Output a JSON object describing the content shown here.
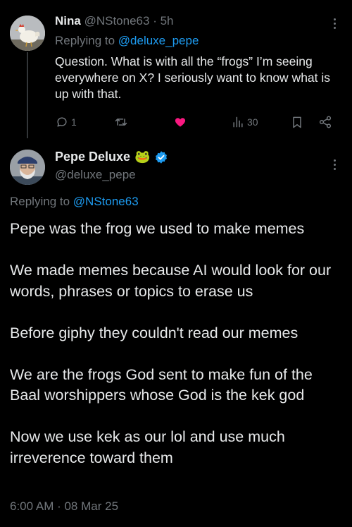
{
  "parent_tweet": {
    "display_name": "Nina",
    "handle": "@NStone63",
    "separator": "·",
    "age": "5h",
    "replying_prefix": "Replying to ",
    "replying_to": "@deluxe_pepe",
    "text": "Question. What is with all the “frogs” I’m seeing everywhere on X? I seriously want to know what is up with that.",
    "reply_count": "1",
    "retweet_count": "",
    "like_count": "",
    "like_color": "#f91880",
    "view_count": "30",
    "icons": [
      "reply-icon",
      "retweet-icon",
      "heart-icon",
      "views-icon",
      "bookmark-icon",
      "share-icon",
      "more-icon"
    ]
  },
  "main_tweet": {
    "display_name": "Pepe Deluxe",
    "name_emoji": "🐸",
    "verified_color": "#1d9bf0",
    "handle": "@deluxe_pepe",
    "replying_prefix": "Replying to ",
    "replying_to": "@NStone63",
    "paragraphs": [
      "Pepe was the frog we used to make memes",
      "We made memes because AI would look for our words, phrases or topics to erase us",
      "Before giphy they couldn't read our memes",
      "We are the frogs God sent to make fun of the Baal worshippers whose God is the kek god",
      "Now we use kek as our lol and use much irreverence toward them"
    ],
    "timestamp": "6:00 AM · 08 Mar 25"
  },
  "colors": {
    "background": "#000000",
    "text_primary": "#e7e9ea",
    "text_secondary": "#71767b",
    "link": "#1d9bf0"
  }
}
